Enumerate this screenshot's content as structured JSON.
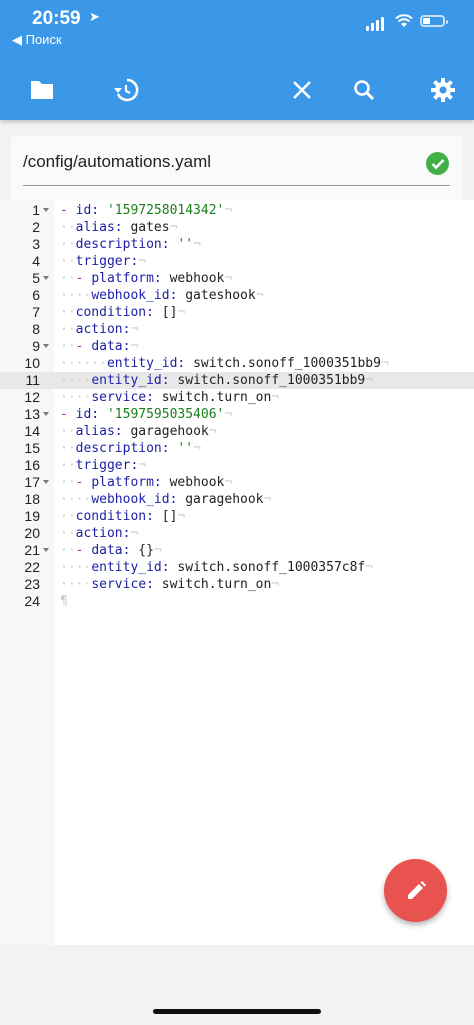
{
  "status_bar": {
    "time": "20:59",
    "back_label": "◀ Поиск"
  },
  "toolbar": {
    "icons": [
      "folder-icon",
      "history-icon",
      "close-icon",
      "search-icon",
      "gear-icon"
    ],
    "color": "#3b98e8"
  },
  "file": {
    "path": "/config/automations.yaml",
    "status": "saved"
  },
  "editor": {
    "active_line": 11,
    "lines": [
      {
        "n": "1",
        "fold": true
      },
      {
        "n": "2"
      },
      {
        "n": "3"
      },
      {
        "n": "4"
      },
      {
        "n": "5",
        "fold": true
      },
      {
        "n": "6"
      },
      {
        "n": "7"
      },
      {
        "n": "8"
      },
      {
        "n": "9",
        "fold": true
      },
      {
        "n": "10"
      },
      {
        "n": "11"
      },
      {
        "n": "12"
      },
      {
        "n": "13",
        "fold": true
      },
      {
        "n": "14"
      },
      {
        "n": "15"
      },
      {
        "n": "16"
      },
      {
        "n": "17",
        "fold": true
      },
      {
        "n": "18"
      },
      {
        "n": "19"
      },
      {
        "n": "20"
      },
      {
        "n": "21",
        "fold": true
      },
      {
        "n": "22"
      },
      {
        "n": "23"
      },
      {
        "n": "24"
      }
    ],
    "code": {
      "l1_id": "'1597258014342'",
      "l2_alias": "gates",
      "l3_desc": "''",
      "l6_webhook_id": "gateshook",
      "l7_condition": "[]",
      "l10_entity": "switch.sonoff_1000351bb9",
      "l11_entity": "switch.sonoff_1000351bb9",
      "l12_service": "switch.turn_on",
      "l13_id": "'1597595035406'",
      "l14_alias": "garagehook",
      "l15_desc": "''",
      "l18_webhook_id": "garagehook",
      "l19_condition": "[]",
      "l21_data": "{}",
      "l22_entity": "switch.sonoff_1000357c8f",
      "l23_service": "switch.turn_on",
      "platform": "webhook"
    }
  },
  "fab": {
    "icon": "pencil-icon",
    "color": "#e8534f"
  }
}
